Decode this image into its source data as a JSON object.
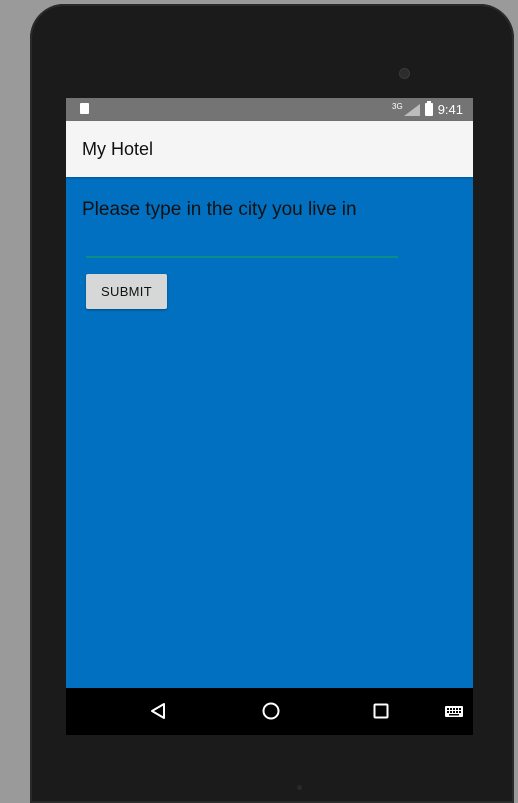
{
  "status_bar": {
    "network": "3G",
    "time": "9:41"
  },
  "app_bar": {
    "title": "My Hotel"
  },
  "main": {
    "prompt": "Please type in the city you live in",
    "city_input": {
      "value": "",
      "placeholder": ""
    },
    "submit_label": "SUBMIT"
  },
  "colors": {
    "background": "#0270c1",
    "app_bar": "#f5f5f5",
    "input_underline": "#0a8f86",
    "button": "#d6d7d7"
  },
  "nav_bar": {
    "icons": [
      "back-icon",
      "home-icon",
      "recents-icon",
      "keyboard-icon"
    ]
  }
}
